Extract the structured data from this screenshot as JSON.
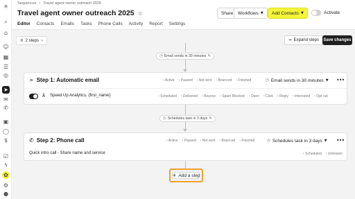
{
  "breadcrumb": {
    "parent": "Sequences",
    "separator": "›",
    "current": "Travel agent owner outreach 2025"
  },
  "header": {
    "title": "Travel agent owner outreach 2025",
    "share_label": "Share",
    "workflows_label": "Workflows",
    "add_contacts_label": "Add Contacts",
    "activate_label": "Activate"
  },
  "tabs": [
    "Editor",
    "Contacts",
    "Emails",
    "Tasks",
    "Phone Calls",
    "Activity",
    "Report",
    "Settings"
  ],
  "toolbar": {
    "steps_label": "2 steps",
    "expand_label": "Expand steps",
    "save_label": "Save changes"
  },
  "flow": {
    "delay1": "Email sends in 30 minutes",
    "delay2": "Schedules task in 3 days",
    "add_step_label": "Add a step"
  },
  "step1": {
    "title": "Step 1: Automatic email",
    "stats": [
      "Active",
      "Paused",
      "Not sent",
      "Bounced",
      "Finished"
    ],
    "schedule": "Email sends in 30 minutes",
    "email_subject": "Speed Up Analytics, {first_name}",
    "email_stats": [
      "Scheduled",
      "Delivered",
      "Bounce",
      "Spam Blocked",
      "Open",
      "Click",
      "Reply",
      "Interested",
      "Opt out"
    ]
  },
  "step2": {
    "title": "Step 2: Phone call",
    "stats": [
      "Active",
      "Paused",
      "Not sent",
      "Bounced",
      "Finished"
    ],
    "schedule": "Schedules task in 3 days",
    "task_text": "Quick intro call - Share name and service",
    "task_stats": [
      "Scheduled",
      "Unknown"
    ]
  },
  "colors": {
    "accent_yellow": "#f4f43a",
    "highlight_orange": "#f0a030",
    "dark": "#1f1f1f"
  }
}
